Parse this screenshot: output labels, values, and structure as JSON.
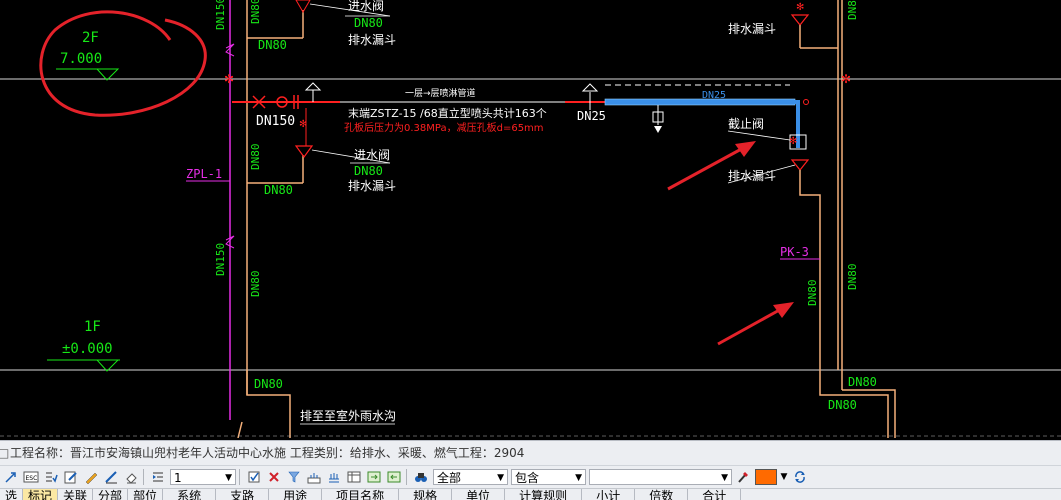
{
  "cad": {
    "level_2f_name": "2F",
    "level_2f_value": "7.000",
    "level_1f_name": "1F",
    "level_1f_value": "±0.000",
    "dn150_top": "DN150",
    "dn80_top1": "DN80",
    "dn80_top2": "DN80",
    "dn80_top3": "DN80",
    "inlet_valve_top": "进水阀",
    "floor_drain_top": "排水漏斗",
    "pipe_title": "一层→层喷淋管道",
    "dn150_label": "DN150",
    "sprinkler_spec": "末端ZSTZ-15 /68直立型喷头共计163个",
    "pressure_spec": "孔板后压力为0.38MPa，减压孔板d=65mm",
    "dn25_label": "DN25",
    "dn25_pipe_label": "DN25",
    "shutoff_valve": "截止阀",
    "floor_drain_right": "排水漏斗",
    "floor_drain_right_top": "排水漏斗",
    "dn80_far_right": "DN80",
    "dn80_right_mid": "DN80",
    "dn80_right_low1": "DN80",
    "dn80_right_low2": "DN80",
    "pk3": "PK-3",
    "zpl1": "ZPL-1",
    "dn150_mid": "DN150",
    "dn80_mid": "DN80",
    "dn80_mid2": "DN80",
    "dn80_lower": "DN80",
    "inlet_valve_mid": "进水阀",
    "dn80_mid_label": "DN80",
    "floor_drain_mid": "排水漏斗",
    "discharge_label": "排至至室外雨水沟",
    "dn80_bottom": "DN80",
    "colors": {
      "green": "#17e817",
      "magenta": "#e62ee6",
      "red": "#ff2020",
      "white": "#ffffff",
      "orange_pipe": "#f5b07a",
      "blue_pipe": "#3a8fe8",
      "annotation_red": "#e4222a"
    }
  },
  "statusbar": {
    "text": "工程名称：晋江市安海镇山兜村老年人活动中心水施  工程类别：给排水、采暖、燃气工程：2904"
  },
  "toolbar": {
    "layer_value": "1",
    "scope_value": "全部",
    "mode_value": "包含",
    "filter_value": ""
  },
  "tabs": {
    "items": [
      "选",
      "标记",
      "关联",
      "分部",
      "部位"
    ],
    "active_index": 1,
    "columns": [
      "系统",
      "支路",
      "用途",
      "项目名称",
      "规格",
      "单位",
      "计算规则",
      "小计",
      "倍数",
      "合计"
    ]
  }
}
